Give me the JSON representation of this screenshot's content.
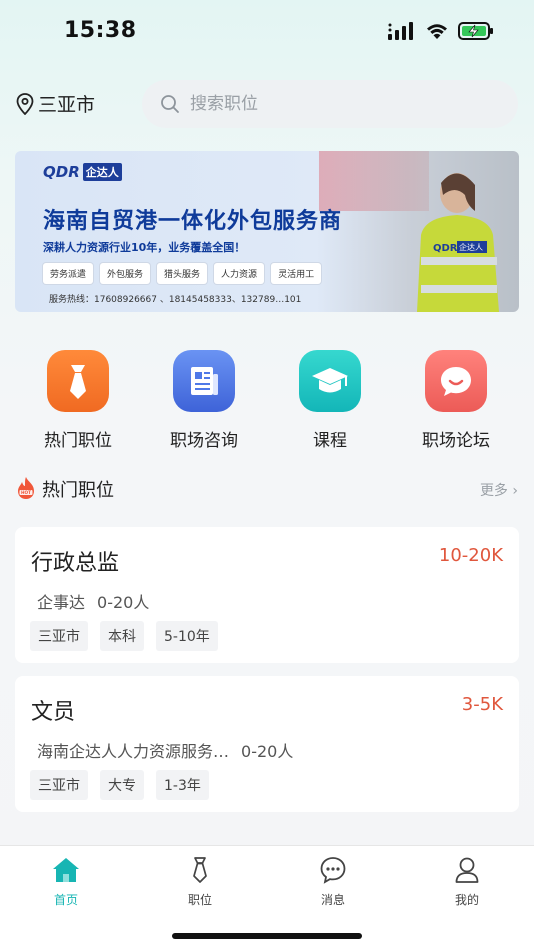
{
  "status_bar": {
    "time": "15:38"
  },
  "header": {
    "location": "三亚市",
    "search_placeholder": "搜索职位"
  },
  "banner": {
    "logo_mark": "QDR",
    "logo_name": "企达人",
    "title": "海南自贸港一体化外包服务商",
    "tagline": "深耕人力资源行业10年，业务覆盖全国！",
    "tags": [
      "劳务派遣",
      "外包服务",
      "猎头服务",
      "人力资源",
      "灵活用工"
    ],
    "hotline": "服务热线：17608926667 、18145458333、13278​9…​101"
  },
  "categories": [
    {
      "label": "热门职位",
      "icon": "tie-icon",
      "color": "#f47a2f"
    },
    {
      "label": "职场咨询",
      "icon": "news-icon",
      "color": "#4f79e8"
    },
    {
      "label": "课程",
      "icon": "graduation-cap-icon",
      "color": "#21c7c4"
    },
    {
      "label": "职场论坛",
      "icon": "chat-bubble-icon",
      "color": "#f36a64"
    }
  ],
  "section": {
    "title": "热门职位",
    "more": "更多 ›"
  },
  "jobs": [
    {
      "title": "行政总监",
      "salary": "10-20K",
      "company": "企事达",
      "size": "0-20人",
      "tags": [
        "三亚市",
        "本科",
        "5-10年"
      ]
    },
    {
      "title": "文员",
      "salary": "3-5K",
      "company": "海南企达人人力资源服务…",
      "size": "0-20人",
      "tags": [
        "三亚市",
        "大专",
        "1-3年"
      ]
    }
  ],
  "tabbar": [
    {
      "label": "首页",
      "icon": "home-icon",
      "active": true
    },
    {
      "label": "职位",
      "icon": "tie-icon",
      "active": false
    },
    {
      "label": "消息",
      "icon": "message-icon",
      "active": false
    },
    {
      "label": "我的",
      "icon": "user-icon",
      "active": false
    }
  ],
  "colors": {
    "accent": "#17b5b3",
    "salary": "#e0573d",
    "brand_blue": "#0f3b9a"
  }
}
